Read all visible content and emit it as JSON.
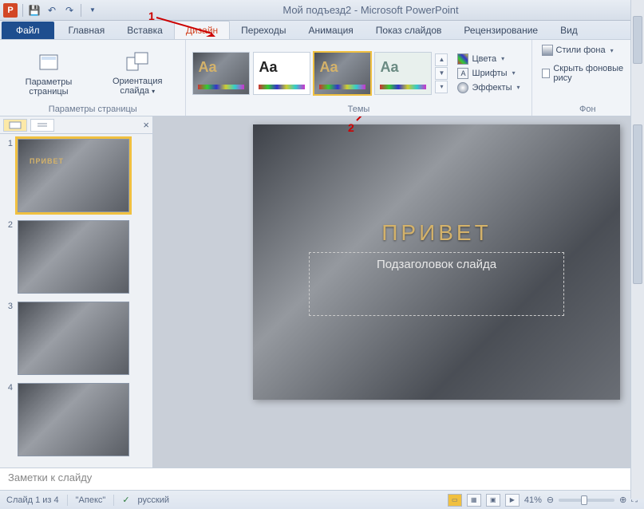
{
  "titlebar": {
    "app_letter": "P",
    "document": "Мой подъезд2",
    "app_name": "Microsoft PowerPoint"
  },
  "tabs": {
    "file": "Файл",
    "home": "Главная",
    "insert": "Вставка",
    "design": "Дизайн",
    "transitions": "Переходы",
    "animations": "Анимация",
    "slideshow": "Показ слайдов",
    "review": "Рецензирование",
    "view": "Вид"
  },
  "ribbon": {
    "page_setup": {
      "params": "Параметры страницы",
      "orientation": "Ориентация слайда",
      "group_label": "Параметры страницы"
    },
    "themes": {
      "group_label": "Темы",
      "colors": "Цвета",
      "fonts": "Шрифты",
      "effects": "Эффекты"
    },
    "background": {
      "styles": "Стили фона",
      "hide": "Скрыть фоновые рису",
      "group_label": "Фон"
    }
  },
  "annotations": {
    "one": "1",
    "two": "2"
  },
  "thumbnails": [
    {
      "num": "1",
      "title": "ПРИВЕТ",
      "selected": true
    },
    {
      "num": "2",
      "title": "",
      "selected": false
    },
    {
      "num": "3",
      "title": "",
      "selected": false
    },
    {
      "num": "4",
      "title": "",
      "selected": false
    }
  ],
  "slide": {
    "title": "ПРИВЕТ",
    "subtitle": "Подзаголовок слайда"
  },
  "notes": {
    "placeholder": "Заметки к слайду"
  },
  "status": {
    "slide_info": "Слайд 1 из 4",
    "theme": "\"Апекс\"",
    "language": "русский",
    "zoom": "41%"
  }
}
